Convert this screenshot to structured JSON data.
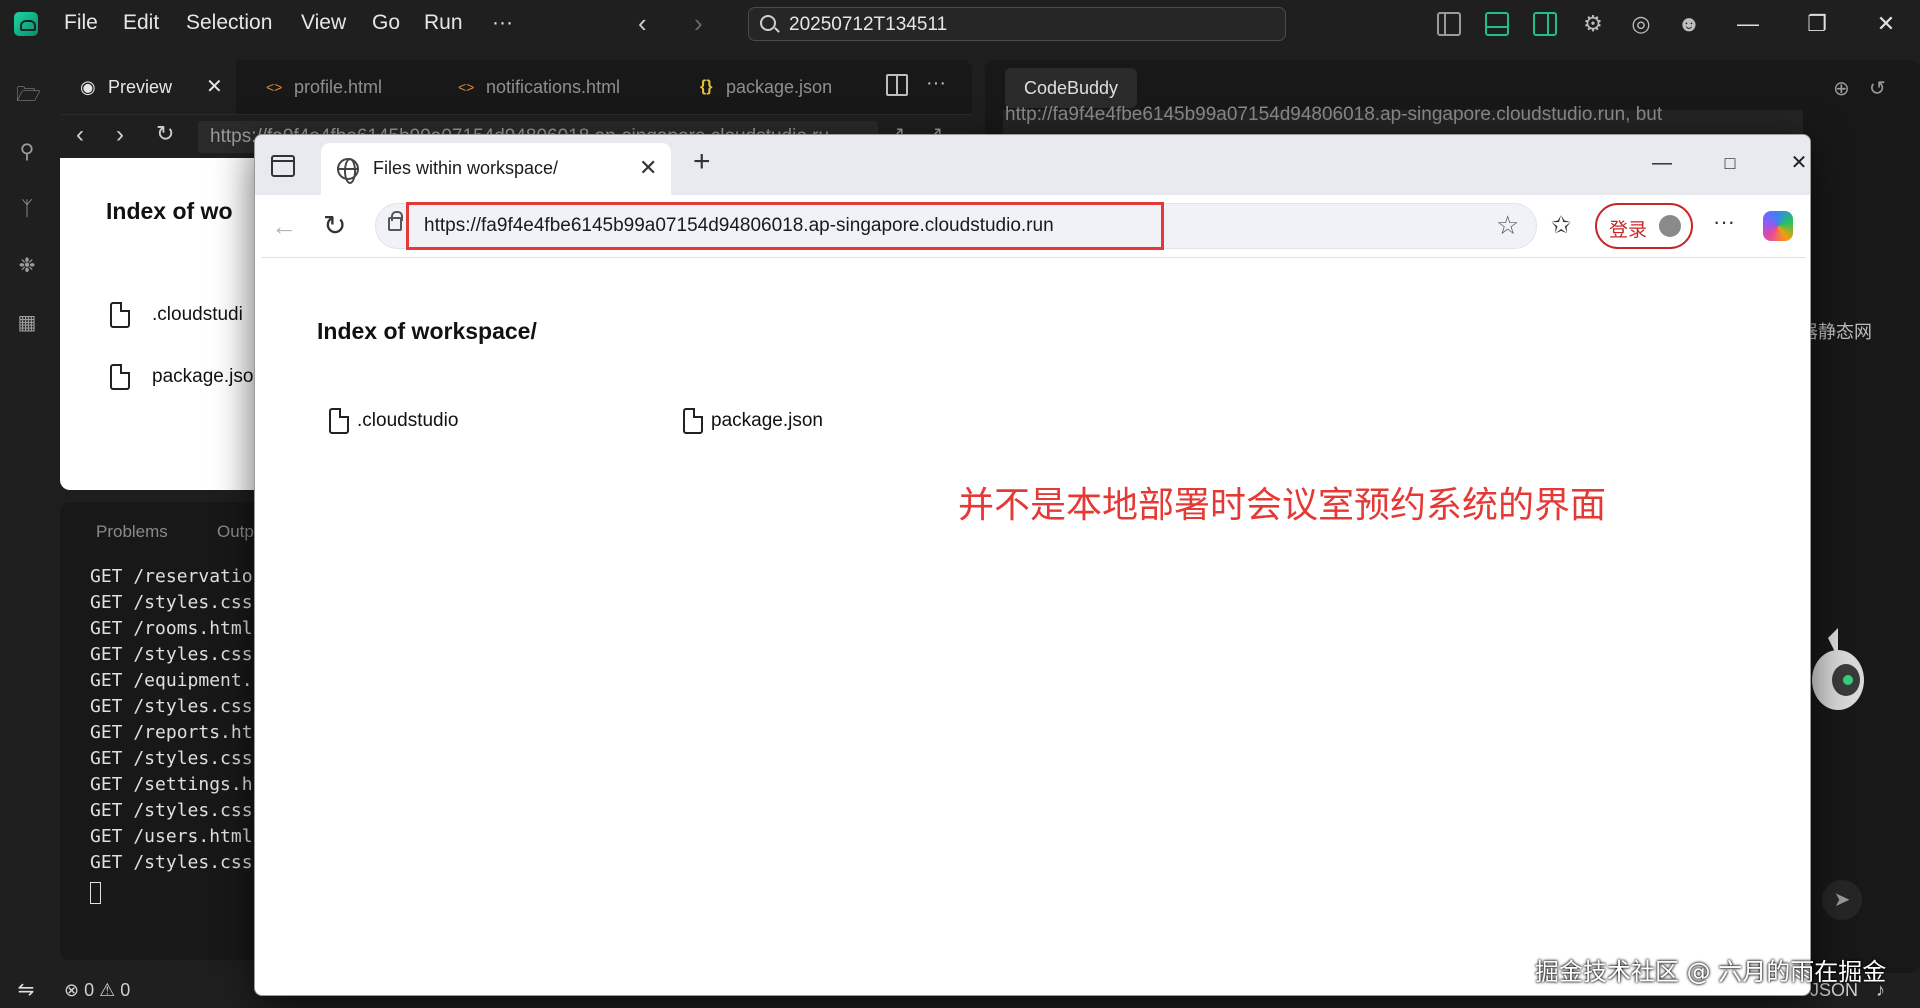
{
  "menubar": {
    "items": [
      "File",
      "Edit",
      "Selection",
      "View",
      "Go",
      "Run",
      "···"
    ],
    "search_text": "20250712T134511"
  },
  "editor": {
    "tabs": [
      {
        "label": "Preview",
        "icon": "eye-icon",
        "active": true
      },
      {
        "label": "profile.html",
        "icon": "code-icon"
      },
      {
        "label": "notifications.html",
        "icon": "code-icon"
      },
      {
        "label": "package.json",
        "icon": "braces-icon"
      }
    ],
    "preview_url": "https://fa9f4e4fbe6145b99a07154d94806018.ap-singapore.cloudstudio.ru",
    "page_title": "Index of  wo",
    "files": [
      ".cloudstudi",
      "package.jso"
    ]
  },
  "panel": {
    "tabs": [
      "Problems",
      "Outp"
    ],
    "terminal_lines": [
      "GET /reservatio",
      "GET /styles.css",
      "GET /rooms.html",
      "GET /styles.css",
      "GET /equipment.",
      "GET /styles.css",
      "GET /reports.ht",
      "GET /styles.css",
      "GET /settings.h",
      "GET /styles.css",
      "GET /users.html",
      "GET /styles.css"
    ]
  },
  "side_panel": {
    "tab_label": "CodeBuddy",
    "url_text": "http://fa9f4e4fbe6145b99a07154d94806018.ap-singapore.cloudstudio.run, but",
    "partial_text": "器静态网"
  },
  "statusbar": {
    "problems": "⊗ 0 ⚠ 0",
    "language": "JSON"
  },
  "browser": {
    "tab_title": "Files within workspace/",
    "url": "https://fa9f4e4fbe6145b99a07154d94806018.ap-singapore.cloudstudio.run",
    "login_label": "登录",
    "page": {
      "title": "Index of  workspace/",
      "files": [
        ".cloudstudio",
        "package.json"
      ]
    }
  },
  "annotation": "并不是本地部署时会议室预约系统的界面",
  "watermark": "掘金技术社区 @ 六月的雨在掘金",
  "colors": {
    "accent_green": "#1fbf8c",
    "highlight_red": "#e53935"
  }
}
